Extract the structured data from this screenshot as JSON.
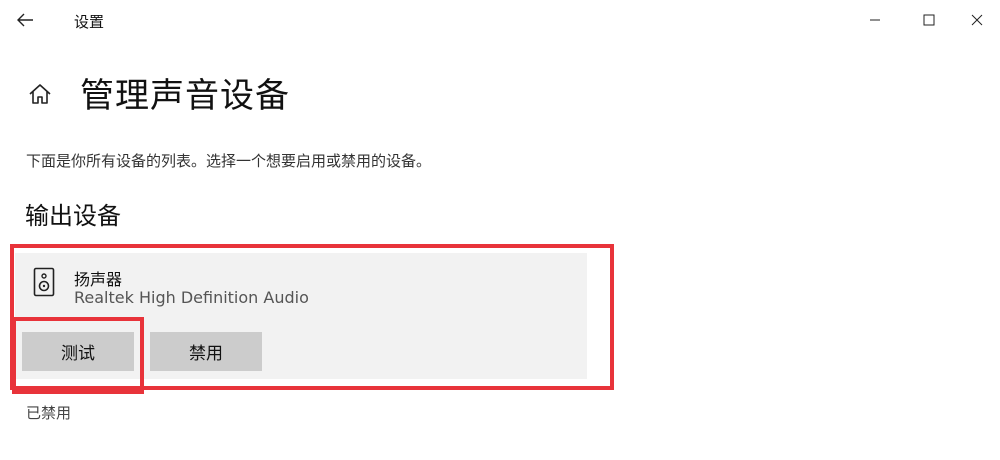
{
  "window": {
    "title": "设置"
  },
  "page": {
    "title": "管理声音设备",
    "description": "下面是你所有设备的列表。选择一个想要启用或禁用的设备。"
  },
  "output_section": {
    "heading": "输出设备",
    "device": {
      "icon": "speaker-icon",
      "name": "扬声器",
      "subtitle": "Realtek High Definition Audio",
      "test_label": "测试",
      "disable_label": "禁用"
    },
    "disabled_label": "已禁用"
  },
  "highlights": {
    "color": "#e8333a"
  }
}
